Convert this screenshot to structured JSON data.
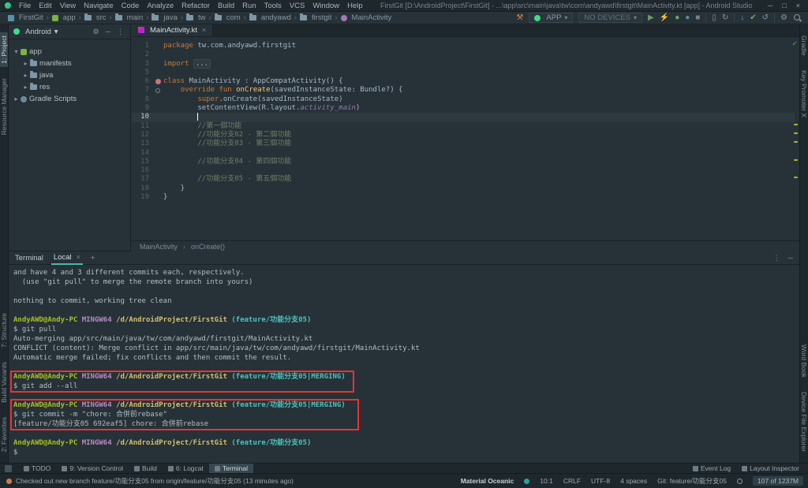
{
  "colors": {
    "accent_red": "#F03030",
    "keyword_orange": "#CC7832",
    "terminal_green": "#A8C023",
    "terminal_magenta": "#B88AC1",
    "terminal_yellow": "#D6BF6E",
    "terminal_cyan": "#4FC1BE",
    "editor_bg": "#263238"
  },
  "glyphs": {
    "caret_down": "▾",
    "chevron": "›",
    "gear": "⚙",
    "dash": "─",
    "more": "⋮",
    "close": "×",
    "plus": "+",
    "maximize": "□",
    "check": "✓"
  },
  "menubar": {
    "menus": [
      "File",
      "Edit",
      "View",
      "Navigate",
      "Code",
      "Analyze",
      "Refactor",
      "Build",
      "Run",
      "Tools",
      "VCS",
      "Window",
      "Help"
    ],
    "title": "FirstGit [D:\\AndroidProject\\FirstGit] - ...\\app\\src\\main\\java\\tw\\com\\andyawd\\firstgit\\MainActivity.kt [app] - Android Studio",
    "window_controls": [
      "─",
      "□",
      "×"
    ]
  },
  "toolbar": {
    "breadcrumbs": [
      {
        "label": "FirstGit",
        "icon": "project"
      },
      {
        "label": "app",
        "icon": "module"
      },
      {
        "label": "src",
        "icon": "folder"
      },
      {
        "label": "main",
        "icon": "folder"
      },
      {
        "label": "java",
        "icon": "folder"
      },
      {
        "label": "tw",
        "icon": "folder"
      },
      {
        "label": "com",
        "icon": "folder"
      },
      {
        "label": "andyawd",
        "icon": "folder"
      },
      {
        "label": "firstgit",
        "icon": "folder"
      },
      {
        "label": "MainActivity",
        "icon": "class"
      }
    ],
    "run_config": "APP",
    "device": "NO DEVICES",
    "actions_left": [
      {
        "name": "build-hammer-icon",
        "glyph": "⚒",
        "color": "#CE8E4E"
      }
    ],
    "actions": [
      {
        "name": "run-icon",
        "glyph": "▶",
        "color": "#6B9A67"
      },
      {
        "name": "apply-changes-icon",
        "glyph": "⚡",
        "color": "#8A959B"
      },
      {
        "name": "debug-icon",
        "glyph": "●",
        "color": "#74A874"
      },
      {
        "name": "profiler-icon",
        "glyph": "●",
        "color": "#5C8FA8"
      },
      {
        "name": "stop-icon",
        "glyph": "■",
        "color": "#77828A"
      },
      {
        "sep": true
      },
      {
        "name": "avd-manager-icon",
        "glyph": "▯",
        "color": "#8A959B"
      },
      {
        "name": "sync-project-icon",
        "glyph": "↻",
        "color": "#8A959B"
      },
      {
        "sep": true
      },
      {
        "name": "vcs-update-icon",
        "glyph": "↓",
        "color": "#6C9BC9"
      },
      {
        "name": "vcs-commit-icon",
        "glyph": "✔",
        "color": "#7FA86F"
      },
      {
        "name": "vcs-history-icon",
        "glyph": "↺",
        "color": "#8A959B"
      },
      {
        "sep": true
      },
      {
        "name": "settings-gear-icon",
        "glyph": "⚙",
        "color": "#8A959B"
      }
    ]
  },
  "left_strip": {
    "top": [
      {
        "label": "1: Project",
        "active": true
      },
      {
        "label": "Resource Manager",
        "active": false
      }
    ],
    "bottom": [
      {
        "label": "7: Structure",
        "active": false
      },
      {
        "label": "Build Variants",
        "active": false
      },
      {
        "label": "2: Favorites",
        "active": false
      }
    ]
  },
  "right_strip": {
    "top": [
      {
        "label": "Gradle",
        "active": false
      },
      {
        "label": "Key Promoter X",
        "active": false
      }
    ],
    "bottom": [
      {
        "label": "Word Book",
        "active": false
      },
      {
        "label": "Device File Explorer",
        "active": false
      }
    ]
  },
  "project": {
    "header": "Android",
    "items": [
      {
        "label": "app",
        "level": 0,
        "expanded": true,
        "icon": "module"
      },
      {
        "label": "manifests",
        "level": 1,
        "expanded": false,
        "icon": "folder"
      },
      {
        "label": "java",
        "level": 1,
        "expanded": false,
        "icon": "folder"
      },
      {
        "label": "res",
        "level": 1,
        "expanded": false,
        "icon": "folder"
      },
      {
        "label": "Gradle Scripts",
        "level": 0,
        "expanded": false,
        "icon": "gradle"
      }
    ]
  },
  "editor": {
    "tab": "MainActivity.kt",
    "breadcrumb": [
      "MainActivity",
      "onCreate()"
    ],
    "lines": [
      {
        "n": "1",
        "tokens": [
          {
            "t": "package ",
            "c": "kw"
          },
          {
            "t": "tw.com.andyawd.firstgit",
            "c": "pl"
          }
        ]
      },
      {
        "n": "2",
        "tokens": []
      },
      {
        "n": "3",
        "tokens": [
          {
            "t": "import ",
            "c": "kw"
          },
          {
            "t": "...",
            "c": "fold"
          }
        ]
      },
      {
        "n": "5",
        "tokens": []
      },
      {
        "n": "6",
        "gicon": "class",
        "tokens": [
          {
            "t": "class ",
            "c": "kw"
          },
          {
            "t": "MainActivity : AppCompatActivity() {",
            "c": "pl"
          }
        ]
      },
      {
        "n": "7",
        "gicon": "override",
        "tokens": [
          {
            "t": "    ",
            "c": "pl"
          },
          {
            "t": "override fun ",
            "c": "kw"
          },
          {
            "t": "onCreate",
            "c": "fn"
          },
          {
            "t": "(savedInstanceState: Bundle?) {",
            "c": "pl"
          }
        ]
      },
      {
        "n": "8",
        "tokens": [
          {
            "t": "        ",
            "c": "pl"
          },
          {
            "t": "super",
            "c": "kw"
          },
          {
            "t": ".onCreate(savedInstanceState)",
            "c": "pl"
          }
        ]
      },
      {
        "n": "9",
        "tokens": [
          {
            "t": "        setContentView(R.layout.",
            "c": "pl"
          },
          {
            "t": "activity_main",
            "c": "res"
          },
          {
            "t": ")",
            "c": "pl"
          }
        ]
      },
      {
        "n": "10",
        "active": true,
        "cursor": true,
        "tokens": [
          {
            "t": "        ",
            "c": "pl"
          }
        ]
      },
      {
        "n": "11",
        "tokens": [
          {
            "t": "        ",
            "c": "pl"
          },
          {
            "t": "//第一個功能",
            "c": "cm"
          }
        ]
      },
      {
        "n": "12",
        "tokens": [
          {
            "t": "        ",
            "c": "pl"
          },
          {
            "t": "//功能分支02 - 第二個功能",
            "c": "cm"
          }
        ]
      },
      {
        "n": "13",
        "tokens": [
          {
            "t": "        ",
            "c": "pl"
          },
          {
            "t": "//功能分支03 - 第三個功能",
            "c": "cm"
          }
        ]
      },
      {
        "n": "14",
        "tokens": []
      },
      {
        "n": "15",
        "tokens": [
          {
            "t": "        ",
            "c": "pl"
          },
          {
            "t": "//功能分支04 - 第四個功能",
            "c": "cm"
          }
        ]
      },
      {
        "n": "16",
        "tokens": []
      },
      {
        "n": "17",
        "tokens": [
          {
            "t": "        ",
            "c": "pl"
          },
          {
            "t": "//功能分支05 - 第五個功能",
            "c": "cm"
          }
        ]
      },
      {
        "n": "18",
        "tokens": [
          {
            "t": "    }",
            "c": "pl"
          }
        ]
      },
      {
        "n": "19",
        "tokens": [
          {
            "t": "}",
            "c": "pl"
          }
        ]
      }
    ]
  },
  "terminal": {
    "title": "Terminal",
    "tab": "Local",
    "lines": [
      {
        "segs": [
          {
            "t": "and have 4 and 3 different commits each, respectively.",
            "c": "tf"
          }
        ]
      },
      {
        "segs": [
          {
            "t": "  (use \"git pull\" to merge the remote branch into yours)",
            "c": "tf"
          }
        ]
      },
      {
        "segs": []
      },
      {
        "segs": [
          {
            "t": "nothing to commit, working tree clean",
            "c": "tf"
          }
        ]
      },
      {
        "segs": []
      },
      {
        "segs": [
          {
            "t": "AndyAWD@Andy-PC ",
            "c": "tg"
          },
          {
            "t": "MINGW64 ",
            "c": "tm"
          },
          {
            "t": "/d/AndroidProject/FirstGit ",
            "c": "ty"
          },
          {
            "t": "(feature/功能分支05)",
            "c": "tc"
          }
        ]
      },
      {
        "segs": [
          {
            "t": "$ git pull",
            "c": "tf"
          }
        ]
      },
      {
        "segs": [
          {
            "t": "Auto-merging app/src/main/java/tw/com/andyawd/firstgit/MainActivity.kt",
            "c": "tf"
          }
        ]
      },
      {
        "segs": [
          {
            "t": "CONFLICT (content): Merge conflict in app/src/main/java/tw/com/andyawd/firstgit/MainActivity.kt",
            "c": "tf"
          }
        ]
      },
      {
        "segs": [
          {
            "t": "Automatic merge failed; fix conflicts and then commit the result.",
            "c": "tf"
          }
        ]
      },
      {
        "segs": []
      },
      {
        "segs": [
          {
            "t": "AndyAWD@Andy-PC ",
            "c": "tg"
          },
          {
            "t": "MINGW64 ",
            "c": "tm"
          },
          {
            "t": "/d/AndroidProject/FirstGit ",
            "c": "ty"
          },
          {
            "t": "(feature/功能分支05|MERGING)",
            "c": "tc"
          }
        ]
      },
      {
        "segs": [
          {
            "t": "$ git add --all",
            "c": "tf"
          }
        ]
      },
      {
        "segs": []
      },
      {
        "segs": [
          {
            "t": "AndyAWD@Andy-PC ",
            "c": "tg"
          },
          {
            "t": "MINGW64 ",
            "c": "tm"
          },
          {
            "t": "/d/AndroidProject/FirstGit ",
            "c": "ty"
          },
          {
            "t": "(feature/功能分支05|MERGING)",
            "c": "tc"
          }
        ]
      },
      {
        "segs": [
          {
            "t": "$ git commit -m \"chore: 合併前rebase\"",
            "c": "tf"
          }
        ]
      },
      {
        "segs": [
          {
            "t": "[feature/功能分支05 692eaf5] chore: 合併前rebase",
            "c": "tf"
          }
        ]
      },
      {
        "segs": []
      },
      {
        "segs": [
          {
            "t": "AndyAWD@Andy-PC ",
            "c": "tg"
          },
          {
            "t": "MINGW64 ",
            "c": "tm"
          },
          {
            "t": "/d/AndroidProject/FirstGit ",
            "c": "ty"
          },
          {
            "t": "(feature/功能分支05)",
            "c": "tc"
          }
        ]
      },
      {
        "segs": [
          {
            "t": "$",
            "c": "tf"
          }
        ]
      }
    ]
  },
  "bottom_bar": {
    "left": [
      {
        "label": "TODO",
        "active": false
      },
      {
        "label": "9: Version Control",
        "active": false
      },
      {
        "label": "Build",
        "active": false
      },
      {
        "label": "6: Logcat",
        "active": false
      },
      {
        "label": "Terminal",
        "active": true
      }
    ],
    "right": [
      {
        "label": "Event Log",
        "active": false
      },
      {
        "label": "Layout Inspector",
        "active": false
      }
    ]
  },
  "status_bar": {
    "message": "Checked out new branch feature/功能分支05 from origin/feature/功能分支05 (13 minutes ago)",
    "right": [
      {
        "label": "Material Oceanic",
        "name": "theme-name"
      },
      {
        "label": "10:1",
        "name": "cursor-position"
      },
      {
        "label": "CRLF",
        "name": "line-separator"
      },
      {
        "label": "UTF-8",
        "name": "file-encoding"
      },
      {
        "label": "4 spaces",
        "name": "indent-style"
      },
      {
        "label": "Git: feature/功能分支05",
        "name": "git-branch"
      }
    ],
    "memory": "107 of 1237M"
  }
}
